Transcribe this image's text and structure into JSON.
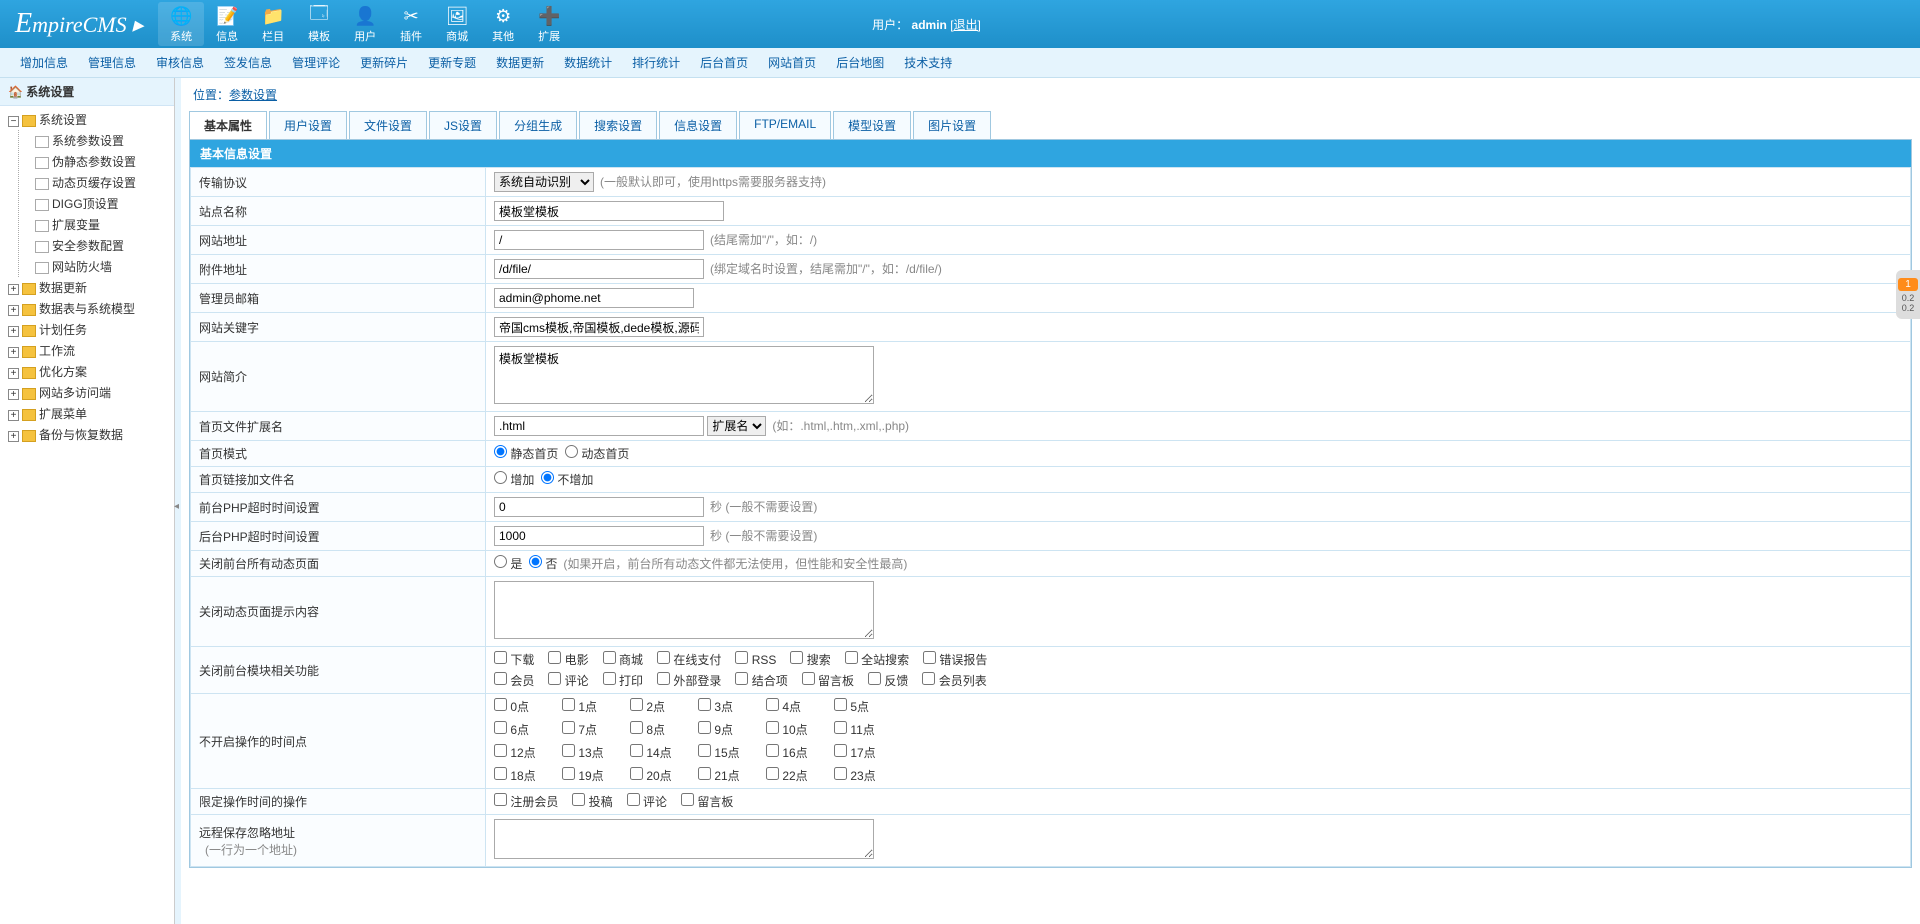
{
  "header": {
    "logo": "EmpireCMS",
    "icons": [
      {
        "label": "系统",
        "glyph": "🌐",
        "active": true
      },
      {
        "label": "信息",
        "glyph": "📝"
      },
      {
        "label": "栏目",
        "glyph": "📁"
      },
      {
        "label": "模板",
        "glyph": "🗔"
      },
      {
        "label": "用户",
        "glyph": "👤"
      },
      {
        "label": "插件",
        "glyph": "✂"
      },
      {
        "label": "商城",
        "glyph": "🖼"
      },
      {
        "label": "其他",
        "glyph": "⚙"
      },
      {
        "label": "扩展",
        "glyph": "➕"
      }
    ],
    "user_label": "用户：",
    "user_name": "admin",
    "logout": "[退出]"
  },
  "subnav": [
    "增加信息",
    "管理信息",
    "审核信息",
    "签发信息",
    "管理评论",
    "更新碎片",
    "更新专题",
    "数据更新",
    "数据统计",
    "排行统计",
    "后台首页",
    "网站首页",
    "后台地图",
    "技术支持"
  ],
  "sidebar": {
    "title": "系统设置",
    "open_group": {
      "label": "系统设置",
      "children": [
        "系统参数设置",
        "伪静态参数设置",
        "动态页缓存设置",
        "DIGG顶设置",
        "扩展变量",
        "安全参数配置",
        "网站防火墙"
      ]
    },
    "groups": [
      "数据更新",
      "数据表与系统模型",
      "计划任务",
      "工作流",
      "优化方案",
      "网站多访问端",
      "扩展菜单",
      "备份与恢复数据"
    ]
  },
  "crumb": {
    "prefix": "位置：",
    "page": "参数设置"
  },
  "tabs": [
    "基本属性",
    "用户设置",
    "文件设置",
    "JS设置",
    "分组生成",
    "搜索设置",
    "信息设置",
    "FTP/EMAIL",
    "模型设置",
    "图片设置"
  ],
  "section_head": "基本信息设置",
  "form": {
    "protocol": {
      "label": "传输协议",
      "select": "系统自动识别",
      "hint": "(一般默认即可，使用https需要服务器支持)"
    },
    "sitename": {
      "label": "站点名称",
      "value": "模板堂模板"
    },
    "siteurl": {
      "label": "网站地址",
      "value": "/",
      "hint": "(结尾需加\"/\"，如：/)"
    },
    "fileurl": {
      "label": "附件地址",
      "value": "/d/file/",
      "hint": "(绑定域名时设置，结尾需加\"/\"，如：/d/file/)"
    },
    "email": {
      "label": "管理员邮箱",
      "value": "admin@phome.net"
    },
    "keywords": {
      "label": "网站关键字",
      "value": "帝国cms模板,帝国模板,dede模板,源码分享,模板"
    },
    "intro": {
      "label": "网站简介",
      "value": "模板堂模板"
    },
    "indexext": {
      "label": "首页文件扩展名",
      "value": ".html",
      "select": "扩展名",
      "hint": "(如：.html,.htm,.xml,.php)"
    },
    "indexmode": {
      "label": "首页模式",
      "opt1": "静态首页",
      "opt2": "动态首页"
    },
    "indexaddfile": {
      "label": "首页链接加文件名",
      "opt1": "增加",
      "opt2": "不增加"
    },
    "fronttimeout": {
      "label": "前台PHP超时时间设置",
      "value": "0",
      "hint": "秒 (一般不需要设置)"
    },
    "backtimeout": {
      "label": "后台PHP超时时间设置",
      "value": "1000",
      "hint": "秒 (一般不需要设置)"
    },
    "closedyn": {
      "label": "关闭前台所有动态页面",
      "opt1": "是",
      "opt2": "否",
      "hint": "(如果开启，前台所有动态文件都无法使用，但性能和安全性最高)"
    },
    "closetip": {
      "label": "关闭动态页面提示内容",
      "value": ""
    },
    "closemods": {
      "label": "关闭前台模块相关功能",
      "row1": [
        "下载",
        "电影",
        "商城",
        "在线支付",
        "RSS",
        "搜索",
        "全站搜索",
        "错误报告"
      ],
      "row2": [
        "会员",
        "评论",
        "打印",
        "外部登录",
        "结合项",
        "留言板",
        "反馈",
        "会员列表"
      ]
    },
    "timepoints": {
      "label": "不开启操作的时间点",
      "items": [
        "0点",
        "1点",
        "2点",
        "3点",
        "4点",
        "5点",
        "6点",
        "7点",
        "8点",
        "9点",
        "10点",
        "11点",
        "12点",
        "13点",
        "14点",
        "15点",
        "16点",
        "17点",
        "18点",
        "19点",
        "20点",
        "21点",
        "22点",
        "23点"
      ]
    },
    "limitops": {
      "label": "限定操作时间的操作",
      "items": [
        "注册会员",
        "投稿",
        "评论",
        "留言板"
      ]
    },
    "remoteignore": {
      "label": "远程保存忽略地址",
      "sub": "(一行为一个地址)",
      "value": ""
    }
  }
}
